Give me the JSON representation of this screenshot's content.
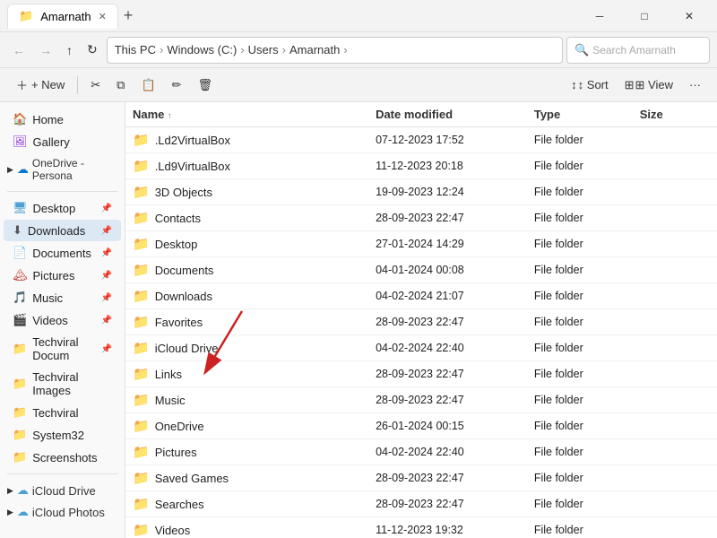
{
  "window": {
    "title": "Amarnath",
    "controls": [
      "─",
      "□",
      "✕"
    ]
  },
  "nav": {
    "back_disabled": true,
    "forward_disabled": true,
    "up_btn": "↑",
    "refresh_btn": "↻",
    "breadcrumb": [
      "This PC",
      "Windows (C:)",
      "Users",
      "Amarnath"
    ],
    "search_placeholder": "Search Amarnath"
  },
  "toolbar": {
    "new_btn": "+ New",
    "cut_icon": "✂",
    "copy_icon": "⧉",
    "paste_icon": "📋",
    "rename_icon": "✏",
    "delete_icon": "🗑",
    "sort_btn": "↕ Sort",
    "view_btn": "⊞ View",
    "more_btn": "···"
  },
  "sidebar": {
    "items": [
      {
        "id": "home",
        "label": "Home",
        "icon": "🏠",
        "icon_color": "#d4a020"
      },
      {
        "id": "gallery",
        "label": "Gallery",
        "icon": "🖼",
        "icon_color": "#8a2be2"
      },
      {
        "id": "onedrive",
        "label": "OneDrive - Persona",
        "icon": "☁",
        "icon_color": "#0078d4",
        "expandable": true
      },
      {
        "id": "desktop",
        "label": "Desktop",
        "icon": "🖥",
        "icon_color": "#4a9fd4",
        "pinned": true
      },
      {
        "id": "downloads",
        "label": "Downloads",
        "icon": "⬇",
        "icon_color": "#555",
        "pinned": true,
        "active": true
      },
      {
        "id": "documents",
        "label": "Documents",
        "icon": "📄",
        "icon_color": "#4a9fd4",
        "pinned": true
      },
      {
        "id": "pictures",
        "label": "Pictures",
        "icon": "🏔",
        "icon_color": "#c0392b",
        "pinned": true
      },
      {
        "id": "music",
        "label": "Music",
        "icon": "🎵",
        "icon_color": "#e74c3c",
        "pinned": true
      },
      {
        "id": "videos",
        "label": "Videos",
        "icon": "🎬",
        "icon_color": "#27ae60",
        "pinned": true
      },
      {
        "id": "techviral_doc",
        "label": "Techviral Docum",
        "icon": "📁",
        "icon_color": "#f0c040",
        "pinned": true
      },
      {
        "id": "techviral_img",
        "label": "Techviral Images",
        "icon": "📁",
        "icon_color": "#f0c040"
      },
      {
        "id": "techviral",
        "label": "Techviral",
        "icon": "📁",
        "icon_color": "#f0c040"
      },
      {
        "id": "system32",
        "label": "System32",
        "icon": "📁",
        "icon_color": "#f0c040"
      },
      {
        "id": "screenshots",
        "label": "Screenshots",
        "icon": "📁",
        "icon_color": "#f0c040"
      },
      {
        "id": "icloud_drive",
        "label": "iCloud Drive",
        "icon": "☁",
        "icon_color": "#4a9fd4",
        "expandable": true
      },
      {
        "id": "icloud_photos",
        "label": "iCloud Photos",
        "icon": "☁",
        "icon_color": "#4a9fd4",
        "expandable": true
      }
    ]
  },
  "columns": {
    "name": "Name",
    "date_modified": "Date modified",
    "type": "Type",
    "size": "Size"
  },
  "files": [
    {
      "name": ".Ld2VirtualBox",
      "date": "07-12-2023 17:52",
      "type": "File folder",
      "icon_type": "folder_plain"
    },
    {
      "name": ".Ld9VirtualBox",
      "date": "11-12-2023 20:18",
      "type": "File folder",
      "icon_type": "folder_plain"
    },
    {
      "name": "3D Objects",
      "date": "19-09-2023 12:24",
      "type": "File folder",
      "icon_type": "folder_3d"
    },
    {
      "name": "Contacts",
      "date": "28-09-2023 22:47",
      "type": "File folder",
      "icon_type": "folder_plain"
    },
    {
      "name": "Desktop",
      "date": "27-01-2024 14:29",
      "type": "File folder",
      "icon_type": "folder_blue"
    },
    {
      "name": "Documents",
      "date": "04-01-2024 00:08",
      "type": "File folder",
      "icon_type": "folder_blue"
    },
    {
      "name": "Downloads",
      "date": "04-02-2024 21:07",
      "type": "File folder",
      "icon_type": "folder_dl"
    },
    {
      "name": "Favorites",
      "date": "28-09-2023 22:47",
      "type": "File folder",
      "icon_type": "folder_plain"
    },
    {
      "name": "iCloud Drive",
      "date": "04-02-2024 22:40",
      "type": "File folder",
      "icon_type": "folder_icloud"
    },
    {
      "name": "Links",
      "date": "28-09-2023 22:47",
      "type": "File folder",
      "icon_type": "folder_plain"
    },
    {
      "name": "Music",
      "date": "28-09-2023 22:47",
      "type": "File folder",
      "icon_type": "folder_music"
    },
    {
      "name": "OneDrive",
      "date": "26-01-2024 00:15",
      "type": "File folder",
      "icon_type": "folder_onedrive"
    },
    {
      "name": "Pictures",
      "date": "04-02-2024 22:40",
      "type": "File folder",
      "icon_type": "folder_pic"
    },
    {
      "name": "Saved Games",
      "date": "28-09-2023 22:47",
      "type": "File folder",
      "icon_type": "folder_plain"
    },
    {
      "name": "Searches",
      "date": "28-09-2023 22:47",
      "type": "File folder",
      "icon_type": "folder_plain"
    },
    {
      "name": "Videos",
      "date": "11-12-2023 19:32",
      "type": "File folder",
      "icon_type": "folder_vid"
    }
  ],
  "annotation": {
    "arrow_target": "iCloud Drive",
    "arrow_from": "Downloads sidebar"
  }
}
